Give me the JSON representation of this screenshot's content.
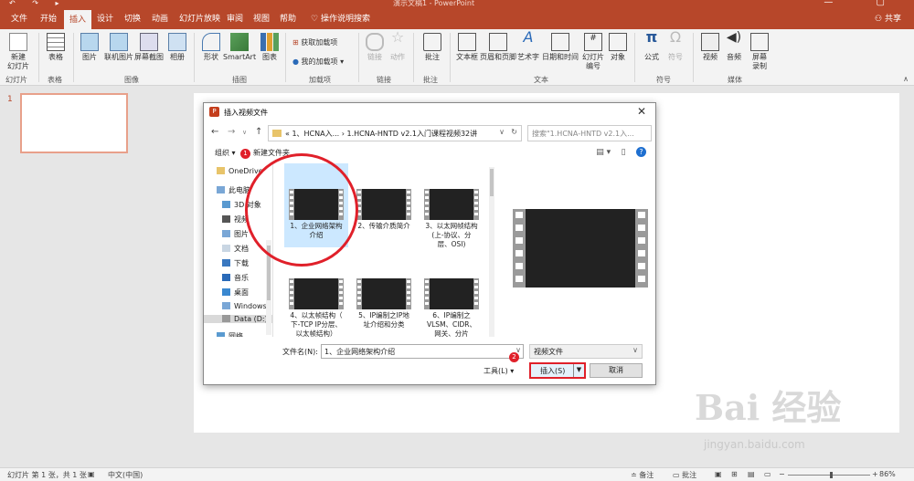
{
  "app": {
    "title": "演示文稿1 - PowerPoint",
    "share": "共享",
    "tell_me": "操作说明搜索"
  },
  "tabs": [
    "文件",
    "开始",
    "插入",
    "设计",
    "切换",
    "动画",
    "幻灯片放映",
    "审阅",
    "视图",
    "帮助"
  ],
  "ribbon": {
    "buttons": [
      {
        "label": "新建\n幻灯片"
      },
      {
        "label": "表格"
      },
      {
        "label": "图片"
      },
      {
        "label": "联机图片"
      },
      {
        "label": "屏幕截图"
      },
      {
        "label": "相册"
      },
      {
        "label": "形状"
      },
      {
        "label": "SmartArt"
      },
      {
        "label": "图表"
      },
      {
        "label": "链接"
      },
      {
        "label": "动作"
      },
      {
        "label": "批注"
      },
      {
        "label": "文本框"
      },
      {
        "label": "页眉和页脚"
      },
      {
        "label": "艺术字"
      },
      {
        "label": "日期和时间"
      },
      {
        "label": "幻灯片\n编号"
      },
      {
        "label": "对象"
      },
      {
        "label": "公式"
      },
      {
        "label": "符号"
      },
      {
        "label": "视频"
      },
      {
        "label": "音频"
      },
      {
        "label": "屏幕\n录制"
      }
    ],
    "addins": {
      "get": "获取加载项",
      "mine": "我的加载项"
    },
    "groups": [
      "幻灯片",
      "表格",
      "图像",
      "插图",
      "加载项",
      "链接",
      "批注",
      "文本",
      "符号",
      "媒体"
    ]
  },
  "slides": {
    "number": "1"
  },
  "dialog": {
    "title": "插入视频文件",
    "path": "«  1、HCNA入...  ›  1.HCNA-HNTD v2.1入门课程视频32讲",
    "search_placeholder": "搜索\"1.HCNA-HNTD v2.1入...",
    "organize": "组织 ▾",
    "new_folder": "新建文件夹",
    "nav_items": [
      "OneDrive",
      "此电脑",
      "3D 对象",
      "视频",
      "图片",
      "文档",
      "下载",
      "音乐",
      "桌面",
      "Windows",
      "Data (D:)",
      "网络"
    ],
    "files": [
      {
        "name": "1、企业网络架构\n介绍"
      },
      {
        "name": "2、传输介质简介"
      },
      {
        "name": "3、以太网帧结构\n(上-协议、分\n层、OSI)"
      },
      {
        "name": "4、以太帧结构（\n下-TCP IP分层、\n以太帧结构）"
      },
      {
        "name": "5、IP编制之IP地\n址介绍和分类"
      },
      {
        "name": "6、IP编制之\nVLSM、CIDR、\n网关、分片"
      }
    ],
    "filename_label": "文件名(N):",
    "filename_value": "1、企业网络架构介绍",
    "filetype_value": "视频文件",
    "tools_label": "工具(L)",
    "insert_label": "插入(S)",
    "cancel_label": "取消",
    "badges": [
      "1",
      "2"
    ]
  },
  "watermark": {
    "text": "Bai 经验",
    "url": "jingyan.baidu.com"
  },
  "status": {
    "slide_info": "幻灯片 第 1 张，共 1 张",
    "language": "中文(中国)",
    "notes": "备注",
    "comments": "批注",
    "zoom": "86%"
  },
  "colors": {
    "accent": "#b7472a",
    "annotation": "#e0202a",
    "selection": "#cce8ff"
  }
}
